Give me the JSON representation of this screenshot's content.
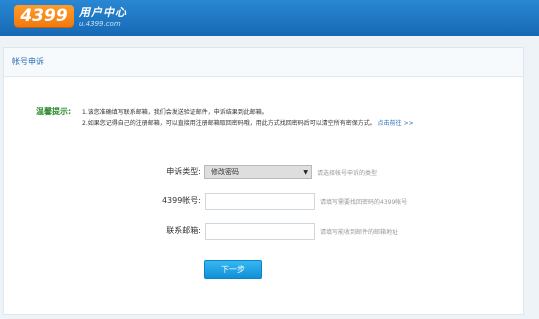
{
  "header": {
    "logo_text": "4399",
    "title": "用户中心",
    "url": "u.4399.com"
  },
  "panel": {
    "title": "帐号申诉"
  },
  "tips": {
    "label": "温馨提示:",
    "line1": "1.该您准确填写联系邮箱，我们会发送验证邮件，申诉结果到此邮箱。",
    "line2": "2.如果您记得自己的注册邮箱，可以直接用注册邮箱取回密码哦，用此方式找回密码后可以清空所有密保方式。",
    "link": "点击前往 >>"
  },
  "form": {
    "type_label": "申诉类型:",
    "type_value": "修改密码",
    "type_hint": "请选择帐号申诉的类型",
    "account_label": "4399帐号:",
    "account_value": "",
    "account_placeholder": "",
    "account_hint": "请填写需要找回密码的4399帐号",
    "email_label": "联系邮箱:",
    "email_value": "",
    "email_placeholder": "",
    "email_hint": "请填写能收到邮件的邮箱地址",
    "submit_label": "下一步"
  },
  "colors": {
    "header_bg": "#1f7cc9",
    "logo_bg": "#f58a1c",
    "tips_label": "#2b8a2b",
    "link": "#2a6fb3",
    "button_bg": "#1ea3e6"
  }
}
